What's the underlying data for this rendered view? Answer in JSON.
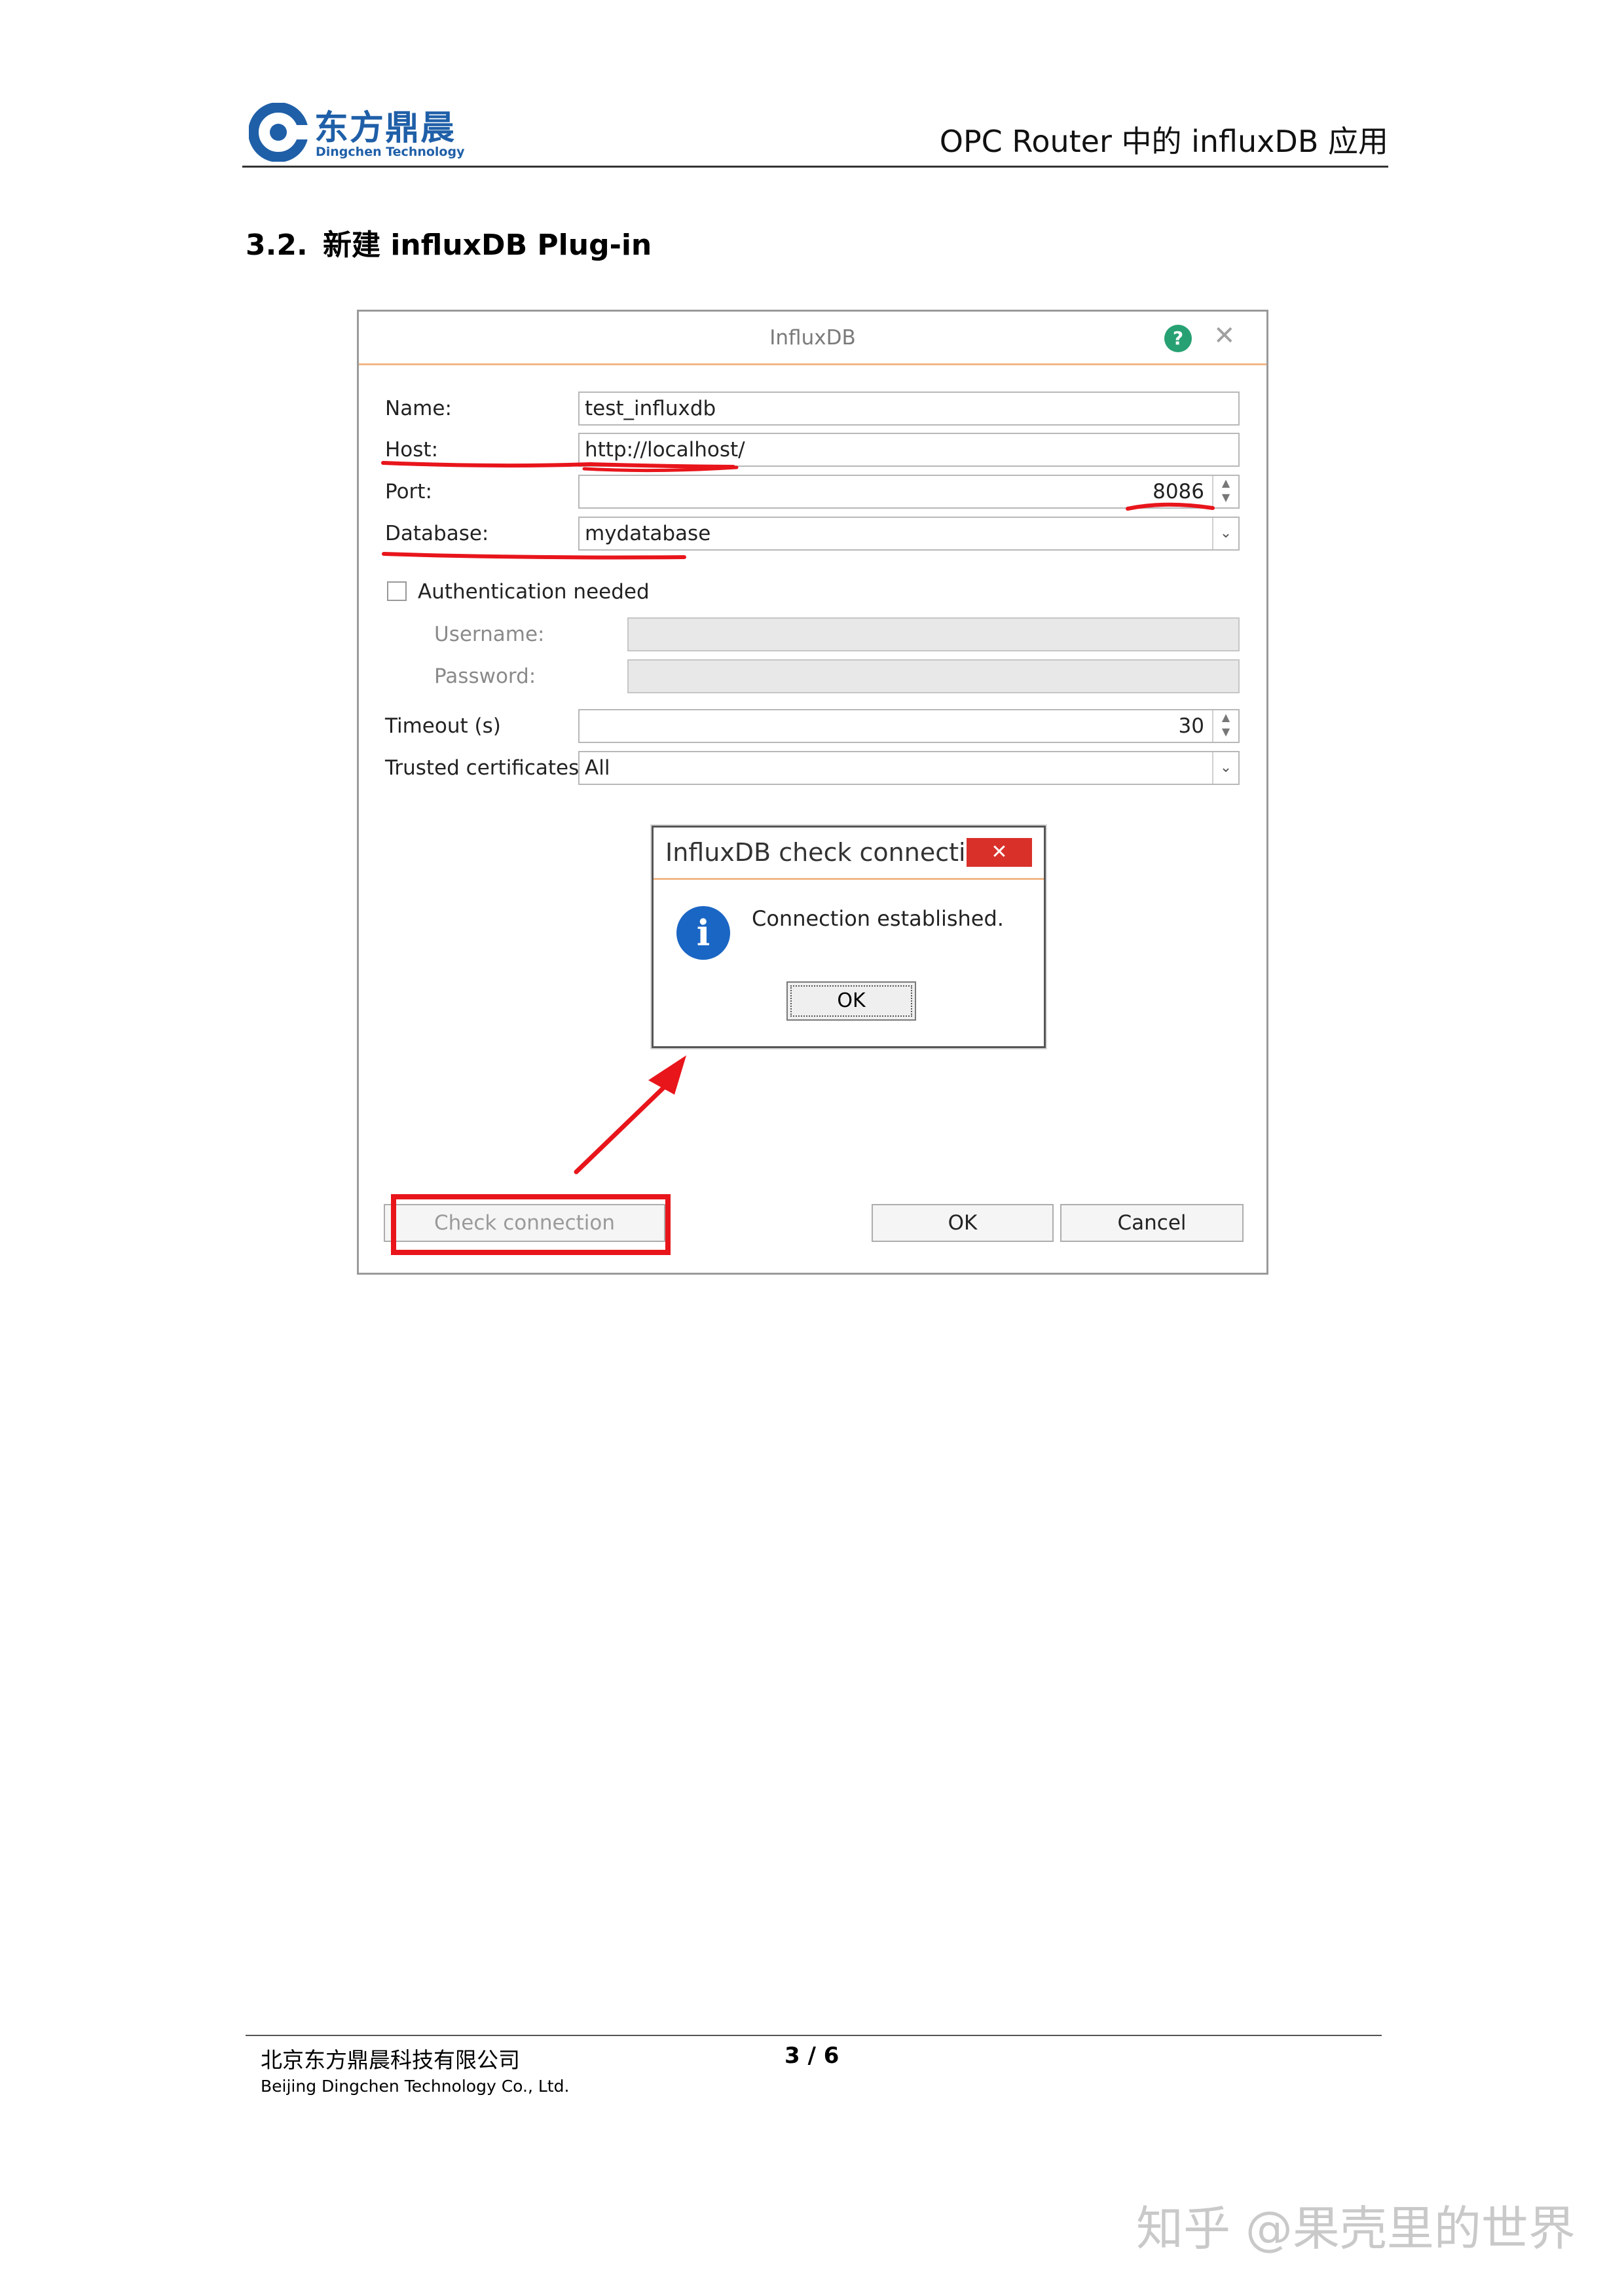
{
  "header": {
    "logo_cn": "东方鼎晨",
    "logo_en": "Dingchen Technology",
    "title": "OPC Router  中的 influxDB 应用"
  },
  "section": {
    "number": "3.2.",
    "title": "新建 influxDB Plug-in"
  },
  "dialog": {
    "title": "InfluxDB",
    "help_glyph": "?",
    "close_glyph": "✕",
    "fields": {
      "name_label": "Name:",
      "name_value": "test_influxdb",
      "host_label": "Host:",
      "host_value": "http://localhost/",
      "port_label": "Port:",
      "port_value": "8086",
      "database_label": "Database:",
      "database_value": "mydatabase",
      "auth_label": "Authentication needed",
      "auth_checked": false,
      "username_label": "Username:",
      "password_label": "Password:",
      "timeout_label": "Timeout (s)",
      "timeout_value": "30",
      "trusted_label": "Trusted certificates:",
      "trusted_value": "All"
    },
    "buttons": {
      "check": "Check connection",
      "ok": "OK",
      "cancel": "Cancel"
    },
    "message_box": {
      "title": "InfluxDB check connection",
      "close_glyph": "✕",
      "info_glyph": "i",
      "text": "Connection established.",
      "ok": "OK"
    },
    "annotation_color": "#e8151b"
  },
  "footer": {
    "company_cn": "北京东方鼎晨科技有限公司",
    "company_en": "Beijing Dingchen Technology Co., Ltd.",
    "page": "3  /  6"
  },
  "watermark": "知乎 @果壳里的世界",
  "colors": {
    "brand": "#1f5fa8",
    "accent_line": "#f2b787",
    "help": "#27a173",
    "info": "#1a66c4",
    "close_red": "#d9302a"
  }
}
